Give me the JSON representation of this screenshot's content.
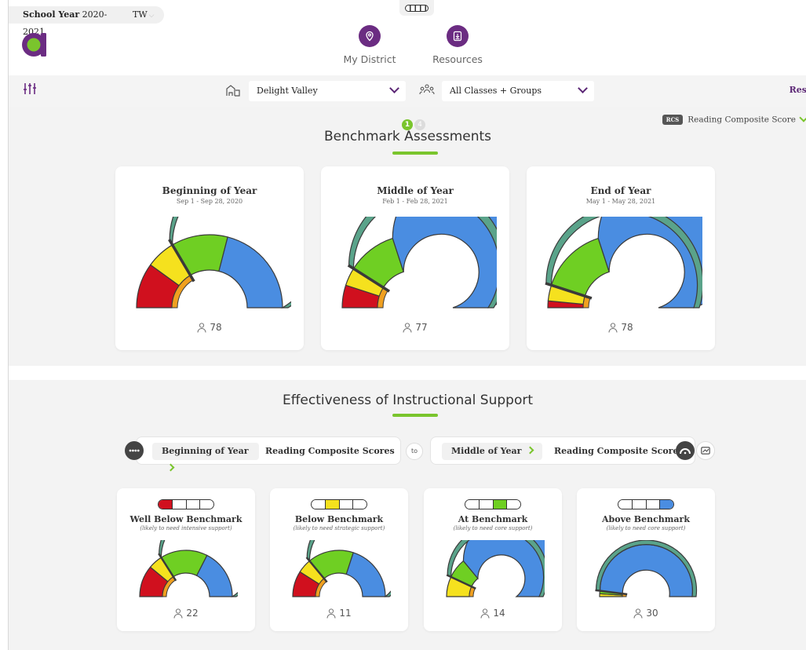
{
  "topbar": {
    "school_year_label": "School Year",
    "school_year_value": "2020-2021",
    "user_initials": "TW",
    "nav": [
      {
        "label": "My District",
        "icon": "location-pin-icon"
      },
      {
        "label": "Resources",
        "icon": "download-document-icon"
      }
    ]
  },
  "filters": {
    "district": "Delight Valley",
    "classes": "All Classes + Groups",
    "reset_label": "Res"
  },
  "benchmark": {
    "page_current": "1",
    "page_total": "4",
    "title": "Benchmark Assessments",
    "measure_badge": "RCS",
    "measure_label": "Reading Composite Score",
    "cards": [
      {
        "title": "Beginning of Year",
        "dates": "Sep 1 - Sep 28, 2020",
        "count": "78"
      },
      {
        "title": "Middle of Year",
        "dates": "Feb 1 - Feb 28, 2021",
        "count": "77"
      },
      {
        "title": "End of Year",
        "dates": "May 1 - May 28, 2021",
        "count": "78"
      }
    ]
  },
  "effectiveness": {
    "title": "Effectiveness of Instructional Support",
    "from_period": "Beginning of Year",
    "from_measure": "Reading Composite Scores",
    "to_label": "to",
    "to_period": "Middle of Year",
    "to_measure": "Reading Composite Scores",
    "cards": [
      {
        "title": "Well Below Benchmark",
        "subtitle": "(likely to need intensive support)",
        "count": "22",
        "highlight_color": "#d0101e"
      },
      {
        "title": "Below Benchmark",
        "subtitle": "(likely to need strategic support)",
        "count": "11",
        "highlight_color": "#f5e11e"
      },
      {
        "title": "At Benchmark",
        "subtitle": "(likely to need core support)",
        "count": "14",
        "highlight_color": "#6fcf23"
      },
      {
        "title": "Above Benchmark",
        "subtitle": "(likely to need core support)",
        "count": "30",
        "highlight_color": "#4a8de1"
      }
    ]
  },
  "colors": {
    "red": "#d0101e",
    "yellow": "#f5e11e",
    "green": "#6fcf23",
    "blue": "#4a8de1",
    "purple": "#6b2c82",
    "accent_green": "#7ac52d"
  },
  "gauges": {
    "benchmark": [
      {
        "red": 0.2,
        "yellow": 0.13,
        "green": 0.25,
        "blue": 0.42,
        "marker": 0.33
      },
      {
        "red": 0.1,
        "yellow": 0.08,
        "green": 0.22,
        "blue": 0.6,
        "marker": 0.18
      },
      {
        "red": 0.03,
        "yellow": 0.07,
        "green": 0.3,
        "blue": 0.6,
        "marker": 0.1
      }
    ],
    "effectiveness": [
      {
        "red": 0.22,
        "yellow": 0.1,
        "green": 0.33,
        "blue": 0.35,
        "marker": 0.32
      },
      {
        "red": 0.18,
        "yellow": 0.1,
        "green": 0.32,
        "blue": 0.4,
        "marker": 0.28
      },
      {
        "red": 0.0,
        "yellow": 0.14,
        "green": 0.14,
        "blue": 0.72,
        "marker": 0.14
      },
      {
        "red": 0.0,
        "yellow": 0.02,
        "green": 0.02,
        "blue": 0.96,
        "marker": 0.04
      }
    ]
  }
}
